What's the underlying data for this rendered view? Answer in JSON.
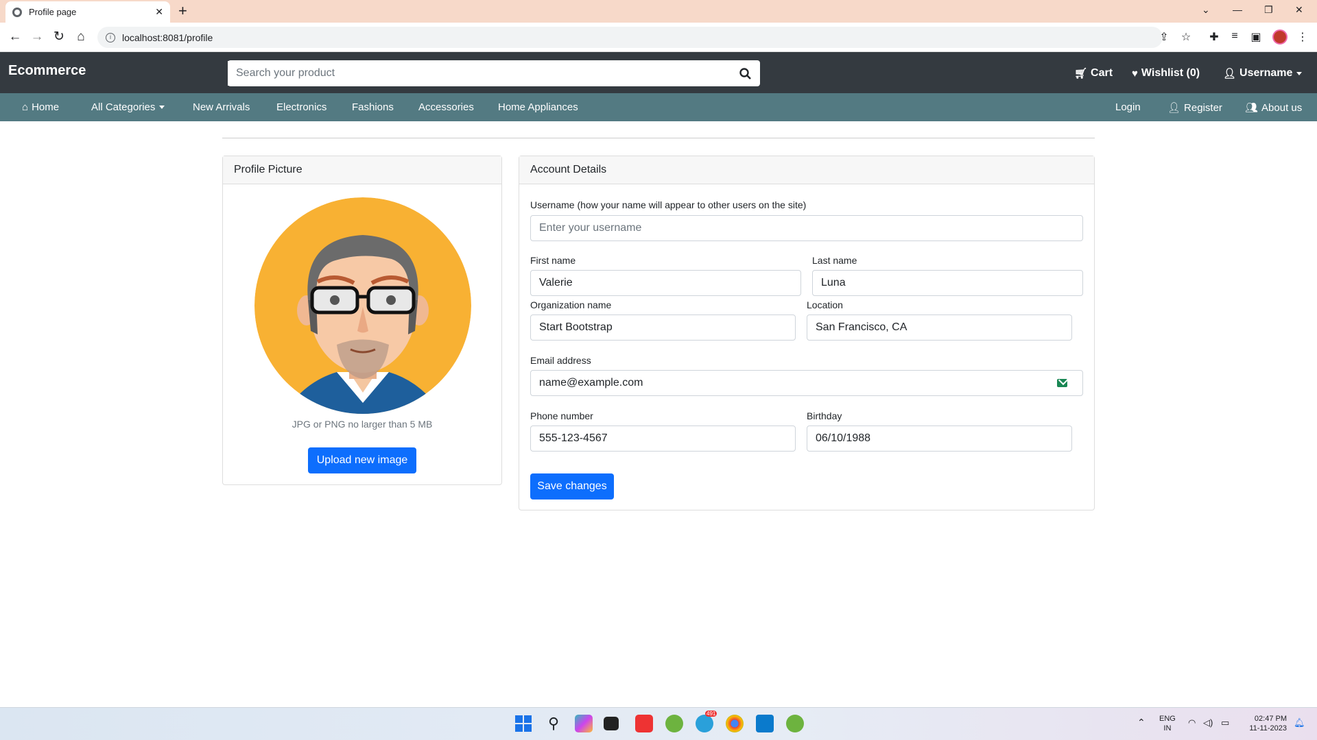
{
  "browser": {
    "tab_title": "Profile page",
    "url": "localhost:8081/profile"
  },
  "header": {
    "brand": "Ecommerce",
    "search_placeholder": "Search your product",
    "cart": "Cart",
    "wishlist": "Wishlist (0)",
    "user": "Username"
  },
  "nav": {
    "items": [
      "Home",
      "All Categories",
      "New Arrivals",
      "Electronics",
      "Fashions",
      "Accessories",
      "Home Appliances"
    ],
    "right": [
      "Login",
      "Register",
      "About us"
    ]
  },
  "profile_picture": {
    "title": "Profile Picture",
    "note": "JPG or PNG no larger than 5 MB",
    "upload_label": "Upload new image"
  },
  "account": {
    "title": "Account Details",
    "username_label": "Username (how your name will appear to other users on the site)",
    "username_placeholder": "Enter your username",
    "first_name_label": "First name",
    "first_name": "Valerie",
    "last_name_label": "Last name",
    "last_name": "Luna",
    "org_label": "Organization name",
    "org": "Start Bootstrap",
    "location_label": "Location",
    "location": "San Francisco, CA",
    "email_label": "Email address",
    "email": "name@example.com",
    "phone_label": "Phone number",
    "phone": "555-123-4567",
    "birthday_label": "Birthday",
    "birthday": "06/10/1988",
    "save_label": "Save changes"
  },
  "taskbar": {
    "lang": "ENG",
    "region": "IN",
    "time": "02:47 PM",
    "date": "11-11-2023",
    "telegram_badge": "491"
  },
  "colors": {
    "appbar": "#343a40",
    "subnav": "#537a82",
    "primary": "#0d6efd"
  }
}
